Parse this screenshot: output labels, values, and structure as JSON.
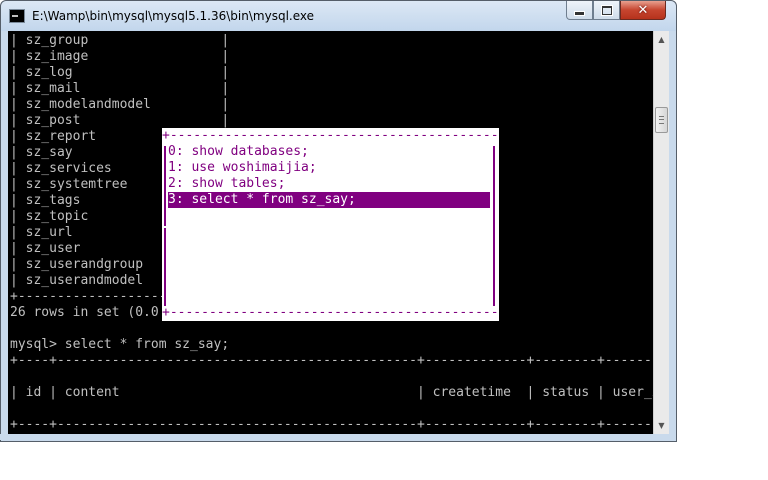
{
  "window": {
    "title": "E:\\Wamp\\bin\\mysql\\mysql5.1.36\\bin\\mysql.exe",
    "controls": {
      "minimize": "minimize",
      "maximize": "maximize",
      "close": "✕"
    }
  },
  "console": {
    "tables": [
      "| sz_group                 |",
      "| sz_image                 |",
      "| sz_log                   |",
      "| sz_mail                  |",
      "| sz_modelandmodel         |",
      "| sz_post                  |",
      "| sz_report",
      "| sz_say",
      "| sz_services",
      "| sz_systemtree",
      "| sz_tags",
      "| sz_topic",
      "| sz_url",
      "| sz_user",
      "| sz_userandgroup",
      "| sz_userandmodel"
    ],
    "table_footer": "+-------------------",
    "rows_line": "26 rows in set (0.0",
    "blank": "",
    "prompt_line": "mysql> select * from sz_say;",
    "result_border_top": "+----+----------------------------------------------+-------------+--------+---------+",
    "result_header": "| id | content                                      | createtime  | status | user_id |",
    "result_border_bottom": "+----+----------------------------------------------+-------------+--------+---------+"
  },
  "popup": {
    "border_top": "+-------------------------------------------------------------------------------+",
    "border_bottom": "+-------------------------------------------------------------------------------+",
    "history": [
      "0: show databases;",
      "1: use woshimaijia;",
      "2: show tables;",
      "3: select * from sz_say;"
    ],
    "selected_index": 3,
    "colors": {
      "text": "#800080",
      "selected_bg": "#800080",
      "selected_text": "#ffffff"
    }
  },
  "scrollbar": {
    "up_icon": "▲",
    "down_icon": "▼"
  }
}
